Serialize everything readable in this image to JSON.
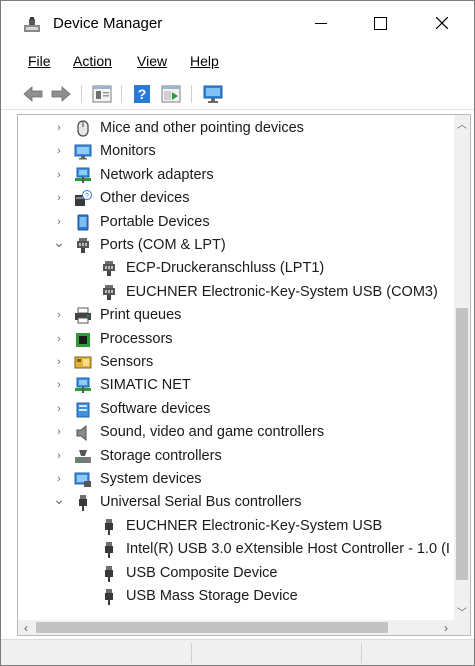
{
  "window": {
    "title": "Device Manager"
  },
  "menu": {
    "file": "File",
    "action": "Action",
    "view": "View",
    "help": "Help"
  },
  "toolbar": {
    "buttons": [
      "back-arrow-icon",
      "forward-arrow-icon",
      "properties-icon",
      "help-icon",
      "update-driver-icon",
      "monitor-scan-icon"
    ]
  },
  "tree": {
    "items": [
      {
        "label": "Mice and other pointing devices",
        "icon": "mouse-icon",
        "level": 1,
        "state": "collapsed"
      },
      {
        "label": "Monitors",
        "icon": "monitor-icon",
        "level": 1,
        "state": "collapsed"
      },
      {
        "label": "Network adapters",
        "icon": "network-adapter-icon",
        "level": 1,
        "state": "collapsed"
      },
      {
        "label": "Other devices",
        "icon": "unknown-device-icon",
        "level": 1,
        "state": "collapsed"
      },
      {
        "label": "Portable Devices",
        "icon": "portable-device-icon",
        "level": 1,
        "state": "collapsed"
      },
      {
        "label": "Ports (COM & LPT)",
        "icon": "port-icon",
        "level": 1,
        "state": "expanded"
      },
      {
        "label": "ECP-Druckeranschluss (LPT1)",
        "icon": "port-icon",
        "level": 2,
        "state": "leaf"
      },
      {
        "label": "EUCHNER Electronic-Key-System USB (COM3)",
        "icon": "port-icon",
        "level": 2,
        "state": "leaf"
      },
      {
        "label": "Print queues",
        "icon": "printer-icon",
        "level": 1,
        "state": "collapsed"
      },
      {
        "label": "Processors",
        "icon": "processor-icon",
        "level": 1,
        "state": "collapsed"
      },
      {
        "label": "Sensors",
        "icon": "sensor-icon",
        "level": 1,
        "state": "collapsed"
      },
      {
        "label": "SIMATIC NET",
        "icon": "network-adapter-icon",
        "level": 1,
        "state": "collapsed"
      },
      {
        "label": "Software devices",
        "icon": "software-device-icon",
        "level": 1,
        "state": "collapsed"
      },
      {
        "label": "Sound, video and game controllers",
        "icon": "speaker-icon",
        "level": 1,
        "state": "collapsed"
      },
      {
        "label": "Storage controllers",
        "icon": "storage-controller-icon",
        "level": 1,
        "state": "collapsed"
      },
      {
        "label": "System devices",
        "icon": "system-device-icon",
        "level": 1,
        "state": "collapsed"
      },
      {
        "label": "Universal Serial Bus controllers",
        "icon": "usb-icon",
        "level": 1,
        "state": "expanded"
      },
      {
        "label": "EUCHNER Electronic-Key-System USB",
        "icon": "usb-icon",
        "level": 2,
        "state": "leaf"
      },
      {
        "label": "Intel(R) USB 3.0 eXtensible Host Controller - 1.0 (I",
        "icon": "usb-icon",
        "level": 2,
        "state": "leaf"
      },
      {
        "label": "USB Composite Device",
        "icon": "usb-icon",
        "level": 2,
        "state": "leaf"
      },
      {
        "label": "USB Mass Storage Device",
        "icon": "usb-icon",
        "level": 2,
        "state": "leaf"
      }
    ]
  },
  "colors": {
    "accent": "#2b79d6",
    "scrollbar_thumb": "#c2c2c2",
    "chevron": "#6b6b6b"
  }
}
